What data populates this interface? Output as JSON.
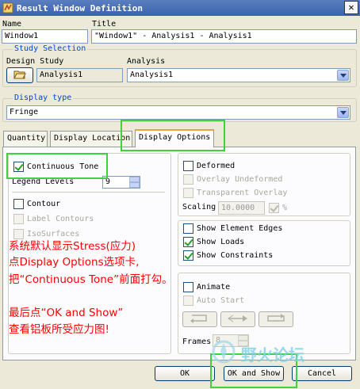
{
  "window": {
    "title": "Result Window Definition",
    "close_glyph": "✕"
  },
  "name": {
    "label": "Name",
    "value": "Window1"
  },
  "title_field": {
    "label": "Title",
    "value": "\"Window1\" - Analysis1 - Analysis1"
  },
  "study_selection": {
    "group_title": "Study Selection",
    "design_study_label": "Design Study",
    "design_study_value": "Analysis1",
    "analysis_label": "Analysis",
    "analysis_value": "Analysis1"
  },
  "display_type": {
    "group_title": "Display type",
    "value": "Fringe"
  },
  "tabs": [
    {
      "label": "Quantity"
    },
    {
      "label": "Display Location"
    },
    {
      "label": "Display Options"
    }
  ],
  "options": {
    "continuous_tone": "Continuous Tone",
    "legend_levels_label": "Legend Levels",
    "legend_levels_value": "9",
    "contour": "Contour",
    "label_contours": "Label Contours",
    "iso_surfaces": "IsoSurfaces",
    "deformed": "Deformed",
    "overlay_undeformed": "Overlay Undeformed",
    "transparent_overlay": "Transparent Overlay",
    "scaling_label": "Scaling",
    "scaling_value": "10.0000",
    "percent": "%",
    "show_element_edges": "Show Element Edges",
    "show_loads": "Show Loads",
    "show_constraints": "Show Constraints",
    "animate": "Animate",
    "auto_start": "Auto Start",
    "frames_label": "Frames",
    "frames_value": "8"
  },
  "buttons": {
    "ok": "OK",
    "ok_and_show": "OK and Show",
    "cancel": "Cancel"
  },
  "annotation": {
    "line1": "系统默认显示Stress(应力)",
    "line2": "点Display Options选项卡,",
    "line3": "把“Continuous Tone”前面打勾。",
    "line4": "最后点“OK and Show”",
    "line5": "查看铝板所受应力图!"
  },
  "watermark": {
    "text": "野火论坛"
  },
  "colors": {
    "annotation": "#ff0000",
    "highlight": "#3fd23f",
    "group_title": "#0046d5"
  }
}
